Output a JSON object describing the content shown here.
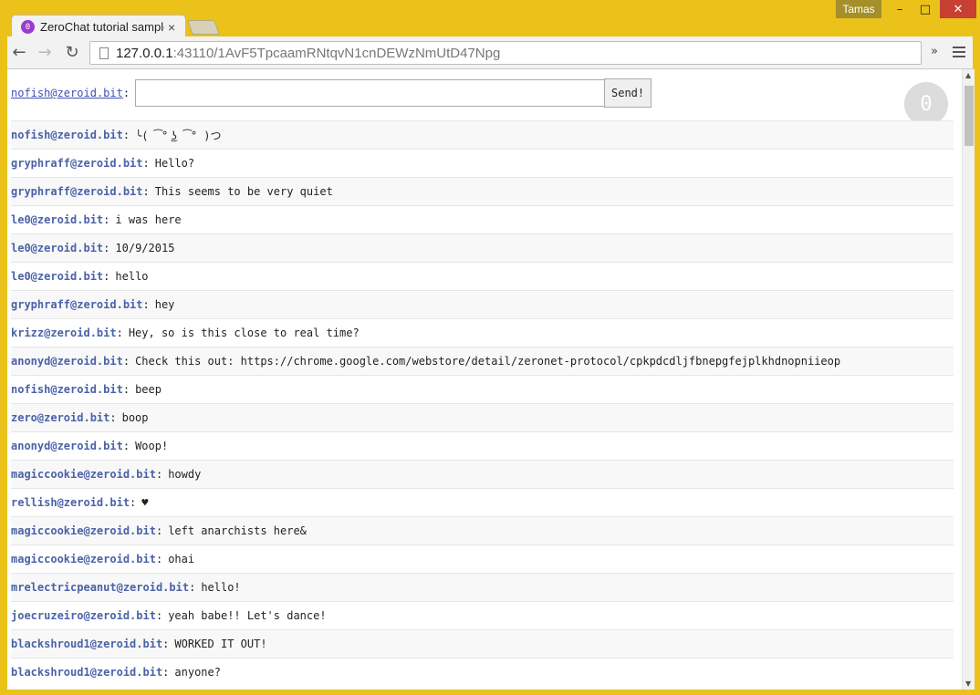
{
  "browser": {
    "tab_title": "ZeroChat tutorial sample",
    "tab_favicon": "0",
    "tab_close": "×",
    "user_badge": "Tamas",
    "url_host": "127.0.0.1",
    "url_rest": ":43110/1AvF5TpcaamRNtqvN1cnDEWzNmUtD47Npg",
    "chevron": "»"
  },
  "compose": {
    "user": "nofish@zeroid.bit",
    "separator": ":",
    "message_value": "",
    "send_label": "Send!"
  },
  "peer_badge": "0",
  "messages": [
    {
      "user": "nofish@zeroid.bit",
      "text": "╰( ͡° ͜ʖ ͡° )つ"
    },
    {
      "user": "gryphraff@zeroid.bit",
      "text": "Hello?"
    },
    {
      "user": "gryphraff@zeroid.bit",
      "text": "This seems to be very quiet"
    },
    {
      "user": "le0@zeroid.bit",
      "text": "i was here"
    },
    {
      "user": "le0@zeroid.bit",
      "text": "10/9/2015"
    },
    {
      "user": "le0@zeroid.bit",
      "text": "hello"
    },
    {
      "user": "gryphraff@zeroid.bit",
      "text": "hey"
    },
    {
      "user": "krizz@zeroid.bit",
      "text": "Hey, so is this close to real time?"
    },
    {
      "user": "anonyd@zeroid.bit",
      "text": "Check this out: https://chrome.google.com/webstore/detail/zeronet-protocol/cpkpdcdljfbnepgfejplkhdnopniieop"
    },
    {
      "user": "nofish@zeroid.bit",
      "text": "beep"
    },
    {
      "user": "zero@zeroid.bit",
      "text": "boop"
    },
    {
      "user": "anonyd@zeroid.bit",
      "text": "Woop!"
    },
    {
      "user": "magiccookie@zeroid.bit",
      "text": "howdy"
    },
    {
      "user": "rellish@zeroid.bit",
      "text": "♥"
    },
    {
      "user": "magiccookie@zeroid.bit",
      "text": "left anarchists here&"
    },
    {
      "user": "magiccookie@zeroid.bit",
      "text": "ohai"
    },
    {
      "user": "mrelectricpeanut@zeroid.bit",
      "text": "hello!"
    },
    {
      "user": "joecruzeiro@zeroid.bit",
      "text": "yeah babe!! Let's dance!"
    },
    {
      "user": "blackshroud1@zeroid.bit",
      "text": "WORKED IT OUT!"
    },
    {
      "user": "blackshroud1@zeroid.bit",
      "text": "anyone?"
    }
  ]
}
